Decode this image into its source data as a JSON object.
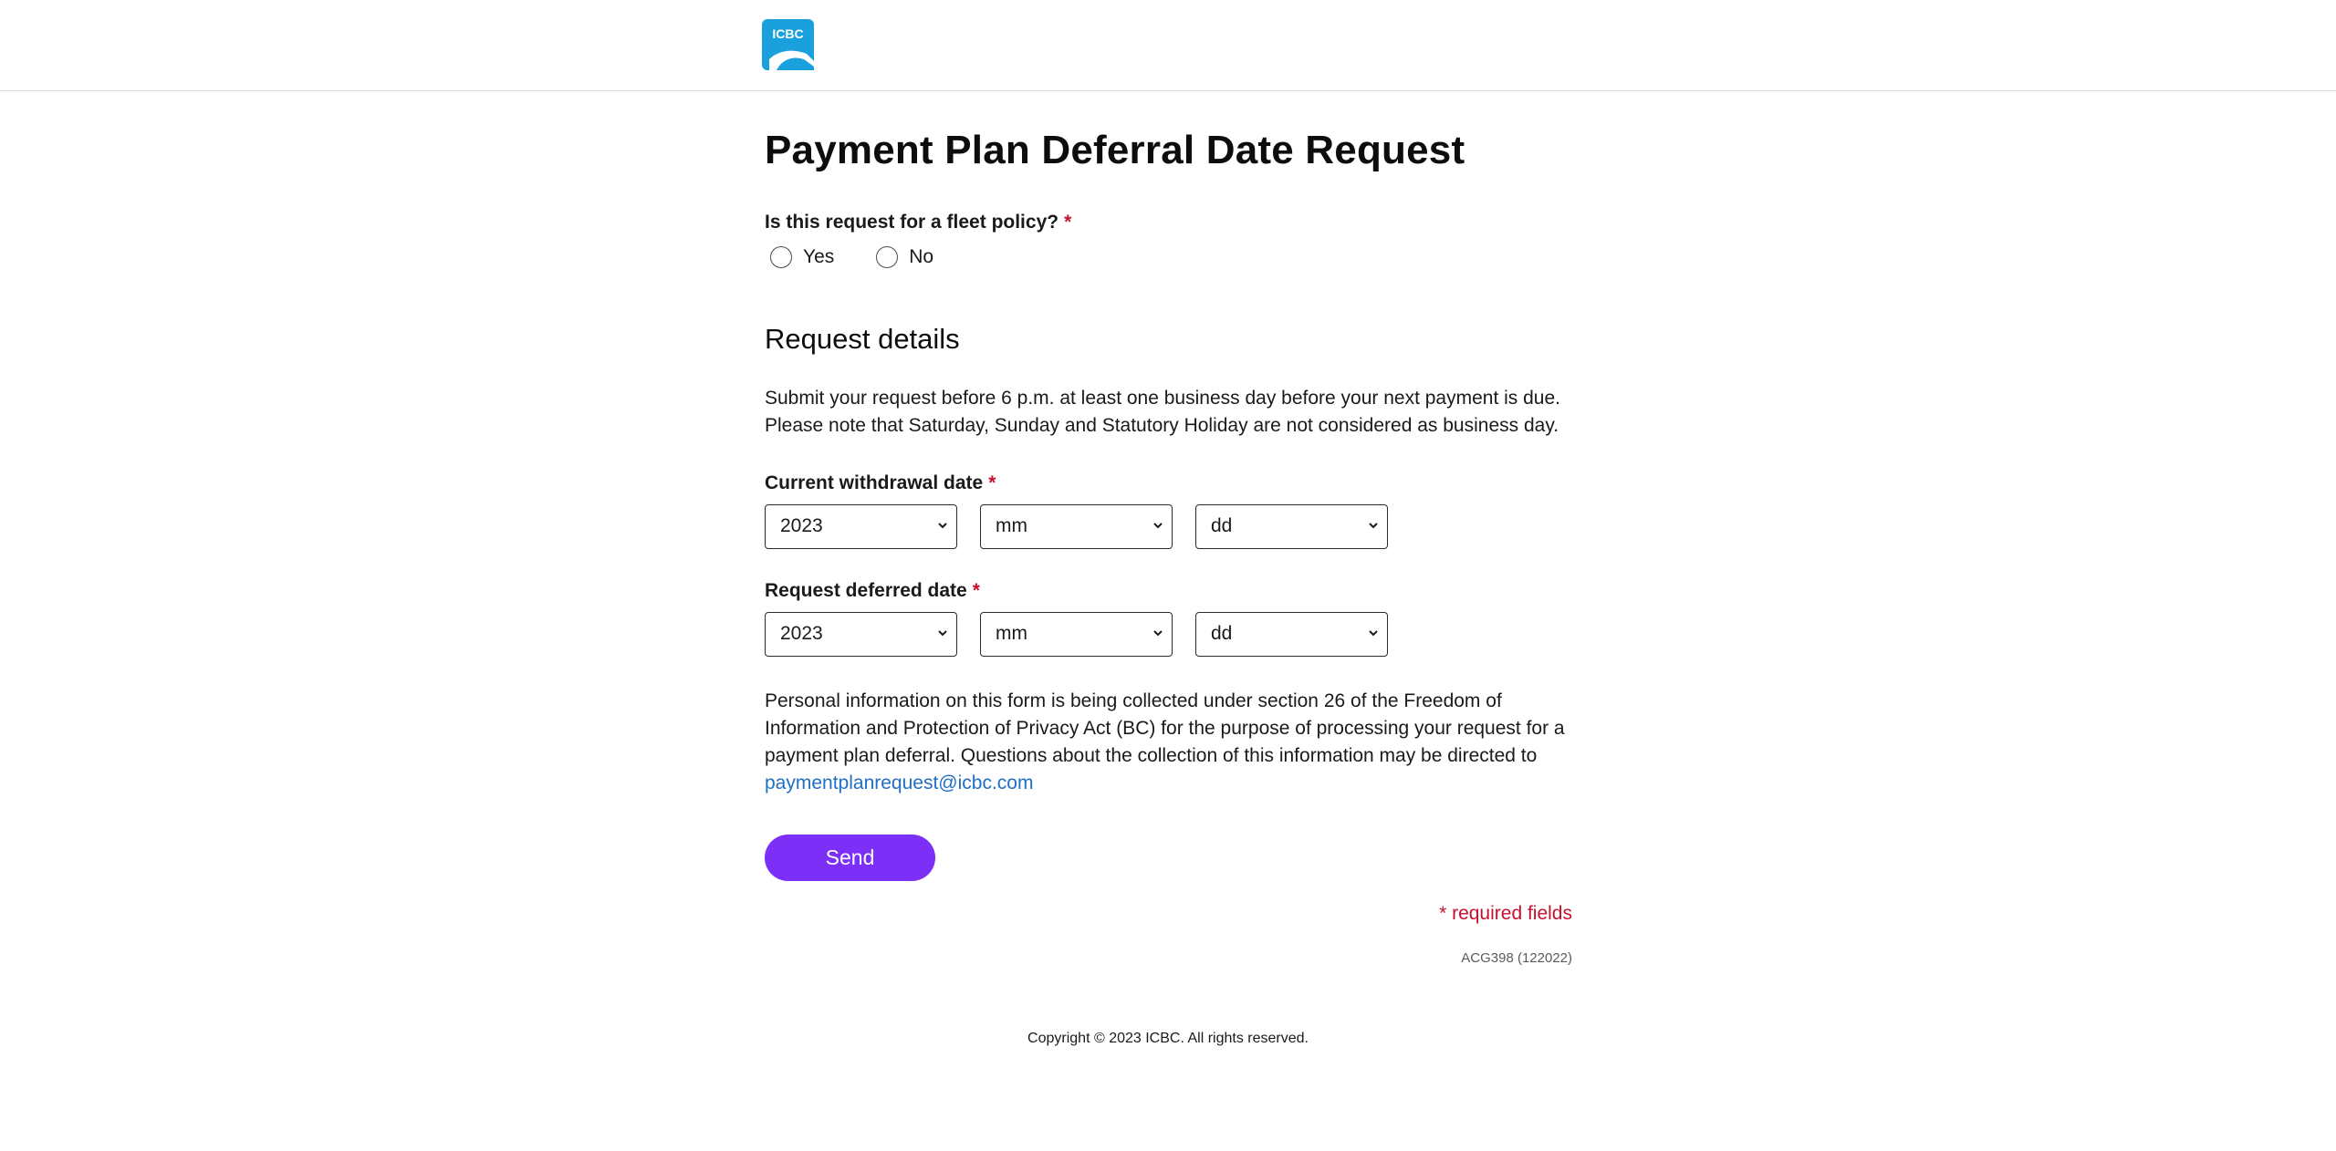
{
  "header": {
    "logo_text": "ICBC",
    "logo_color": "#1aa0dc"
  },
  "form": {
    "title": "Payment Plan Deferral Date Request",
    "fleet_question": "Is this request for a fleet policy?",
    "required_marker": "*",
    "fleet_options": [
      "Yes",
      "No"
    ],
    "section_title": "Request details",
    "intro_line1": "Submit your request before 6 p.m. at least one business day before your next payment is due.",
    "intro_line2": "Please note that Saturday, Sunday and Statutory Holiday are not considered as business day.",
    "withdrawal": {
      "label": "Current withdrawal date",
      "year": "2023",
      "month": "mm",
      "day": "dd"
    },
    "deferred": {
      "label": "Request deferred date",
      "year": "2023",
      "month": "mm",
      "day": "dd"
    },
    "privacy_text": "Personal information on this form is being collected under section 26 of the Freedom of Information and Protection of Privacy Act (BC) for the purpose of processing your request for a payment plan deferral. Questions about the collection of this information may be directed to",
    "privacy_email": "paymentplanrequest@icbc.com",
    "send_label": "Send",
    "required_note": "* required fields",
    "form_code": "ACG398 (122022)"
  },
  "footer": {
    "copyright": "Copyright © 2023 ICBC. All rights reserved."
  },
  "colors": {
    "accent": "#7b2ff7",
    "required": "#c8102e",
    "link": "#1f6fc6"
  }
}
